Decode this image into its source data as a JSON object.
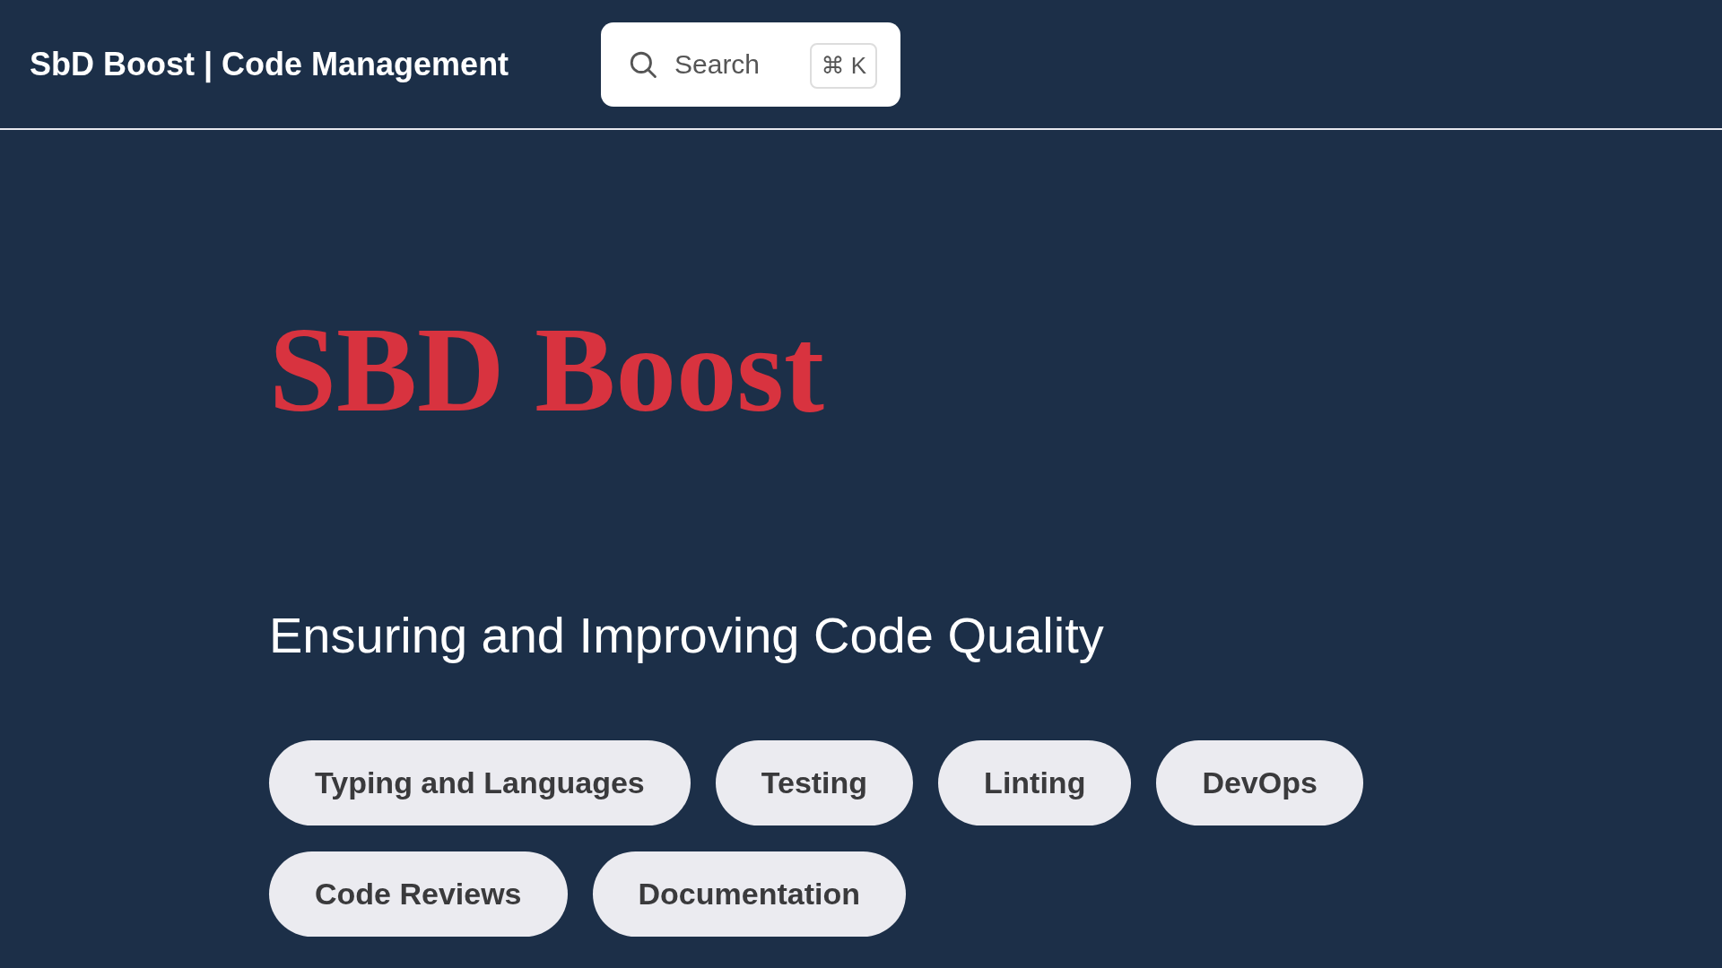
{
  "header": {
    "site_title": "SbD Boost | Code Management",
    "search": {
      "placeholder": "Search",
      "shortcut": "⌘ K"
    }
  },
  "hero": {
    "title": "SBD Boost",
    "tagline": "Ensuring and Improving Code Quality",
    "topics": [
      {
        "label": "Typing and Languages"
      },
      {
        "label": "Testing"
      },
      {
        "label": "Linting"
      },
      {
        "label": "DevOps"
      },
      {
        "label": "Code Reviews"
      },
      {
        "label": "Documentation"
      }
    ]
  }
}
